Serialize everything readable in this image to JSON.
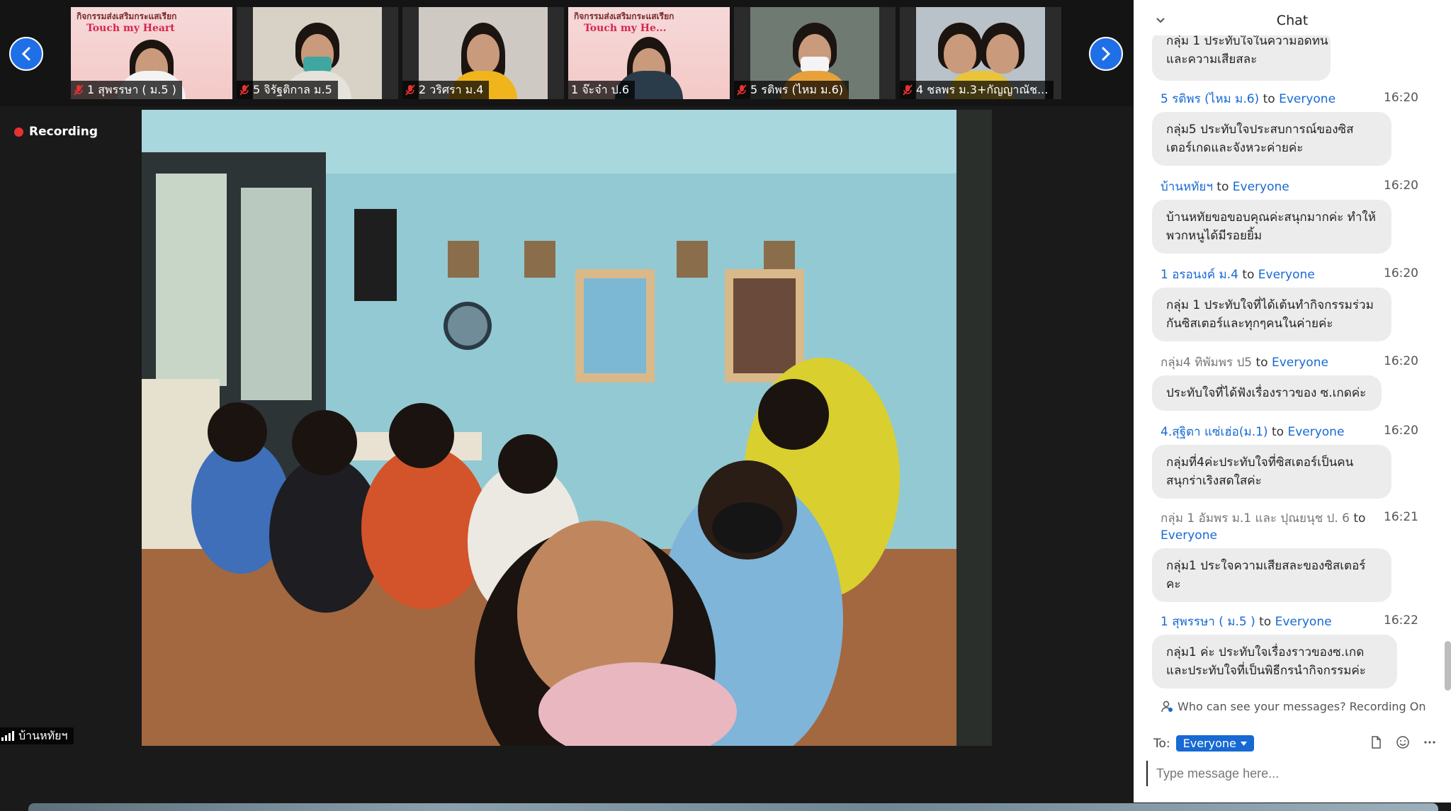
{
  "thumbnails": [
    {
      "name": "1 สุพรรษา ( ม.5 )",
      "muted": true,
      "banner_line": "กิจกรรมส่งเสริมกระแสเรียก",
      "banner_title": "Touch my Heart"
    },
    {
      "name": "5 จิรัฐติกาล ม.5",
      "muted": true
    },
    {
      "name": "2 วริศรา ม.4",
      "muted": true
    },
    {
      "name": "1 จ๊ะจ๋า ป.6",
      "muted": false,
      "banner_line": "กิจกรรมส่งเสริมกระแสเรียก",
      "banner_title": "Touch my He..."
    },
    {
      "name": "5 รติพร (ไหม ม.6)",
      "muted": true
    },
    {
      "name": "4 ชลพร ม.3+กัญญาณัช...",
      "muted": true
    }
  ],
  "recording_label": "Recording",
  "active_speaker": "บ้านหทัยฯ",
  "chat": {
    "title": "Chat",
    "partial_top": [
      "กลุ่ม 1 ประทับใจในความอดทน",
      "และความเสียสละ"
    ],
    "messages": [
      {
        "sender": "5 รติพร (ไหม ม.6)",
        "to": "to",
        "recipient": "Everyone",
        "time": "16:20",
        "lines": [
          "กลุ่ม5 ประทับใจประสบการณ์ของซิส",
          "เตอร์เกดและจังหวะค่ายค่ะ"
        ]
      },
      {
        "sender": "บ้านหทัยฯ",
        "to": "to",
        "recipient": "Everyone",
        "time": "16:20",
        "lines": [
          "บ้านหทัยขอขอบคุณค่ะสนุกมากค่ะ ทำให้",
          "พวกหนูได้มีรอยยิ้ม"
        ]
      },
      {
        "sender": "1  อรอนงค์  ม.4",
        "to": "to",
        "recipient": "Everyone",
        "time": "16:20",
        "lines": [
          "กลุ่ม 1 ประทับใจที่ได้เต้นทำกิจกรรมร่วม",
          "กันซิสเตอร์และทุกๆคนในค่ายค่ะ"
        ]
      },
      {
        "sender": "กลุ่ม4  ทิพัมพร ป5",
        "sender_gray": true,
        "to": "to",
        "recipient": "Everyone",
        "time": "16:20",
        "lines": [
          "ประทับใจที่ได้ฟังเรื่องราวของ ซ.เกดค่ะ"
        ]
      },
      {
        "sender": "4.สุฐิตา แซ่เฮ่อ(ม.1)",
        "to": "to",
        "recipient": "Everyone",
        "time": "16:20",
        "lines": [
          "กลุ่มที่4ค่ะประทับใจที่ซิสเตอร์เป็นคน",
          "สนุกร่าเริงสดใสค่ะ"
        ]
      },
      {
        "sender": "กลุ่ม 1 อัมพร   ม.1 และ ปุณยนุช ป. 6",
        "sender_gray": true,
        "to": "to",
        "recipient": "Everyone",
        "time": "16:21",
        "lines": [
          "กลุ่ม1 ประใจความเสียสละของซิสเตอร์",
          "คะ"
        ]
      },
      {
        "sender": "1 สุพรรษา ( ม.5 )",
        "to": "to",
        "recipient": "Everyone",
        "time": "16:22",
        "lines": [
          "กลุ่ม1 ค่ะ ประทับใจเรื่องราวของซ.เกด",
          "และประทับใจที่เป็นพิธีกรนำกิจกรรมค่ะ"
        ]
      }
    ],
    "privacy_text": "Who can see your messages? Recording On",
    "to_label": "To:",
    "to_value": "Everyone",
    "input_placeholder": "Type message here..."
  },
  "colors": {
    "accent": "#1769d4",
    "record": "#e8322f"
  }
}
